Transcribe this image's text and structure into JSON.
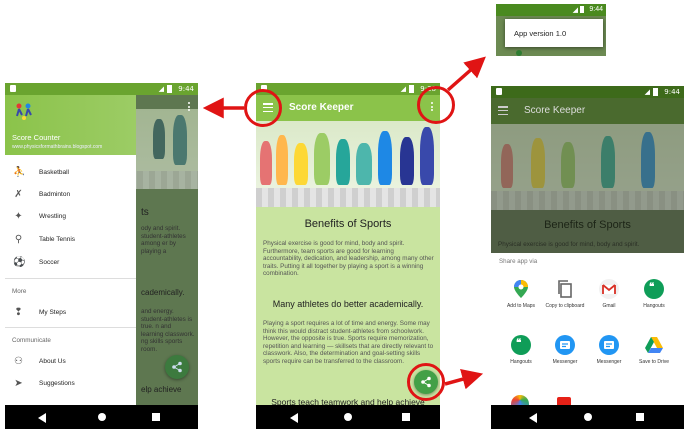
{
  "app": {
    "title": "Score Keeper",
    "drawer_title": "Score Counter",
    "drawer_url": "www.physicsformathbrains.blogspot.com",
    "status_time": "9:44",
    "status_time_main": "9:38",
    "popup_item": "App version 1.0"
  },
  "drawer": {
    "sports": [
      {
        "label": "Basketball",
        "icon": "basketball-player-icon"
      },
      {
        "label": "Badminton",
        "icon": "badminton-player-icon"
      },
      {
        "label": "Wrestling",
        "icon": "wrestling-icon"
      },
      {
        "label": "Table Tennis",
        "icon": "table-tennis-icon"
      },
      {
        "label": "Soccer",
        "icon": "soccer-player-icon"
      }
    ],
    "more_header": "More",
    "more_items": [
      {
        "label": "My Steps",
        "icon": "footsteps-icon"
      }
    ],
    "communicate_header": "Communicate",
    "communicate_items": [
      {
        "label": "About Us",
        "icon": "people-icon"
      },
      {
        "label": "Suggestions",
        "icon": "send-icon"
      }
    ]
  },
  "article": {
    "heading1": "Benefits of Sports",
    "para1": "Physical exercise is good for mind, body and spirit. Furthermore, team sports are good for learning accountability, dedication, and leadership, among many other traits. Putting it all together by playing a sport is a winning combination.",
    "heading2": "Many athletes do better academically.",
    "para2": "Playing a sport requires a lot of time and energy. Some may think this would distract student-athletes from schoolwork. However, the opposite is true. Sports require memorization, repetition and learning — skillsets that are directly relevant to classwork. Also, the determination and goal-setting skills sports require can be transferred to the classroom.",
    "heading3": "Sports teach teamwork and help achieve",
    "drawer_peek_heading": "ts",
    "drawer_peek_text1": "ody and spirit. student-athletes among er by playing a",
    "drawer_peek_heading2": "cademically.",
    "drawer_peek_text2": "and energy. student-athletes is true. n and learning classwork. ng skills sports room.",
    "drawer_peek_heading3": "elp achieve"
  },
  "share": {
    "title": "Share app via",
    "header_heading": "Benefits of Sports",
    "header_text": "Physical exercise is good for mind, body and spirit.",
    "apps": [
      {
        "label": "Add to Maps",
        "icon": "maps-icon",
        "color": "#ffffff"
      },
      {
        "label": "Copy to clipboard",
        "icon": "copy-icon",
        "color": "#ffffff"
      },
      {
        "label": "Gmail",
        "icon": "gmail-icon",
        "color": "#ffffff"
      },
      {
        "label": "Hangouts",
        "icon": "hangouts-icon",
        "color": "#0f9d58"
      },
      {
        "label": "Hangouts",
        "icon": "hangouts-icon",
        "color": "#0f9d58"
      },
      {
        "label": "Messenger",
        "icon": "messenger-icon",
        "color": "#2196f3"
      },
      {
        "label": "Messenger",
        "icon": "messenger-icon",
        "color": "#2196f3"
      },
      {
        "label": "Save to Drive",
        "icon": "drive-icon",
        "color": "#ffffff"
      }
    ]
  },
  "colors": {
    "primary": "#8bc34a",
    "primary_dark": "#6aa42f",
    "fab": "#43a047",
    "annotation": "#e01414"
  }
}
